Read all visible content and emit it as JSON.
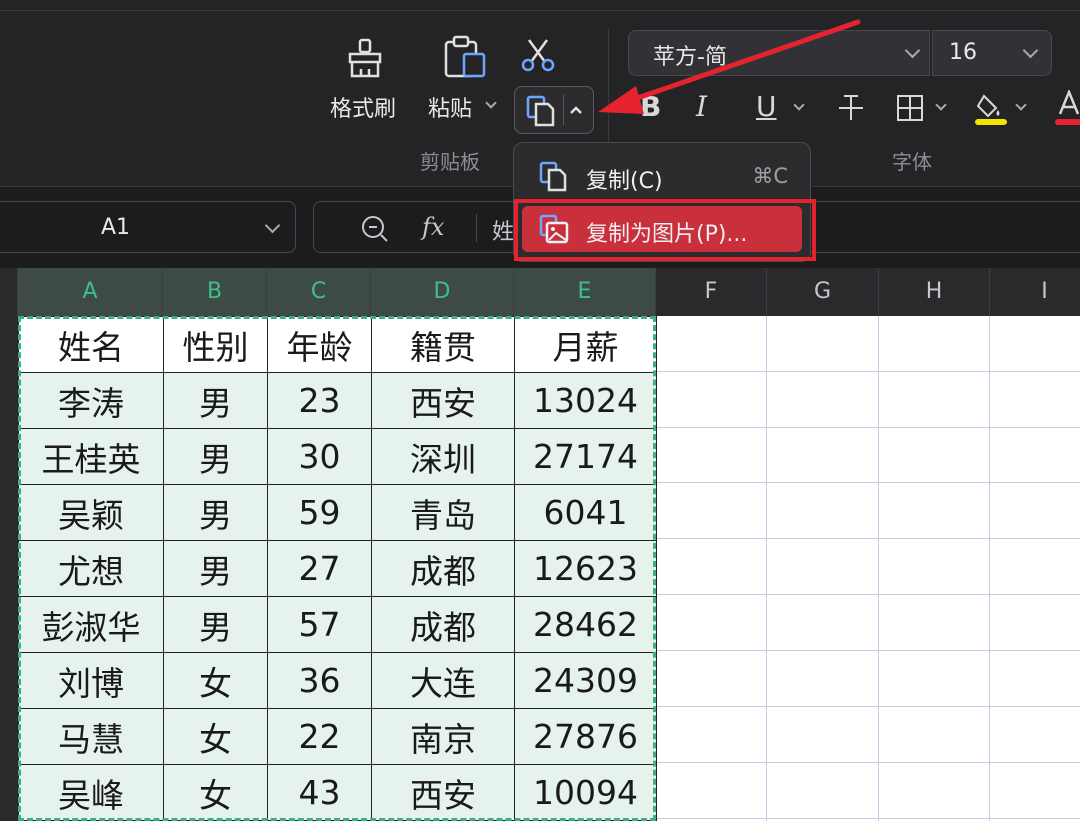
{
  "ribbon": {
    "format_painter_label": "格式刷",
    "paste_label": "粘贴",
    "clipboard_group": "剪贴板",
    "font_group": "字体",
    "font_name": "苹方-简",
    "font_size": "16"
  },
  "menu": {
    "copy_label": "复制(C)",
    "copy_shortcut": "⌘C",
    "copy_as_picture_label": "复制为图片(P)..."
  },
  "formula_bar": {
    "cell_ref": "A1",
    "fx_label": "fx",
    "content_visible": "姓"
  },
  "columns": [
    "A",
    "B",
    "C",
    "D",
    "E",
    "F",
    "G",
    "H",
    "I"
  ],
  "table": {
    "headers": [
      "姓名",
      "性别",
      "年龄",
      "籍贯",
      "月薪"
    ],
    "rows": [
      [
        "李涛",
        "男",
        "23",
        "西安",
        "13024"
      ],
      [
        "王桂英",
        "男",
        "30",
        "深圳",
        "27174"
      ],
      [
        "吴颖",
        "男",
        "59",
        "青岛",
        "6041"
      ],
      [
        "尤想",
        "男",
        "27",
        "成都",
        "12623"
      ],
      [
        "彭淑华",
        "男",
        "57",
        "成都",
        "28462"
      ],
      [
        "刘博",
        "女",
        "36",
        "大连",
        "24309"
      ],
      [
        "马慧",
        "女",
        "22",
        "南京",
        "27876"
      ],
      [
        "吴峰",
        "女",
        "43",
        "西安",
        "10094"
      ]
    ]
  },
  "colors": {
    "accent_green": "#3fbf8a",
    "highlight_red": "#e5232f",
    "menu_highlight": "#c9303c",
    "selection_fill": "#e6f3ec"
  }
}
